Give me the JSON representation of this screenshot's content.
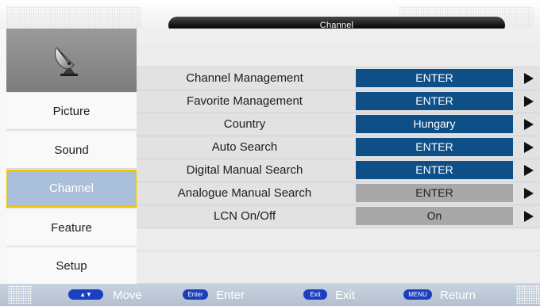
{
  "header": {
    "title": "Channel"
  },
  "sidebar": {
    "icon": "satellite-dish-icon",
    "items": [
      {
        "label": "Picture",
        "active": false
      },
      {
        "label": "Sound",
        "active": false
      },
      {
        "label": "Channel",
        "active": true
      },
      {
        "label": "Feature",
        "active": false
      },
      {
        "label": "Setup",
        "active": false
      }
    ]
  },
  "settings": {
    "rows": [
      {
        "label": "Channel Management",
        "value": "ENTER",
        "enabled": true
      },
      {
        "label": "Favorite Management",
        "value": "ENTER",
        "enabled": true
      },
      {
        "label": "Country",
        "value": "Hungary",
        "enabled": true
      },
      {
        "label": "Auto Search",
        "value": "ENTER",
        "enabled": true
      },
      {
        "label": "Digital Manual Search",
        "value": "ENTER",
        "enabled": true
      },
      {
        "label": "Analogue Manual Search",
        "value": "ENTER",
        "enabled": false
      },
      {
        "label": "LCN On/Off",
        "value": "On",
        "enabled": false
      }
    ]
  },
  "footer": {
    "hints": [
      {
        "badge": "▲▼",
        "label": "Move"
      },
      {
        "badge": "Enter",
        "label": "Enter"
      },
      {
        "badge": "Exit",
        "label": "Exit"
      },
      {
        "badge": "MENU",
        "label": "Return"
      }
    ]
  },
  "colors": {
    "value_active": "#0e4f88",
    "value_disabled": "#a8a8a8",
    "menu_active": "#aac0da",
    "menu_active_border": "#f0c400",
    "footer_badge": "#1a3fbf"
  }
}
